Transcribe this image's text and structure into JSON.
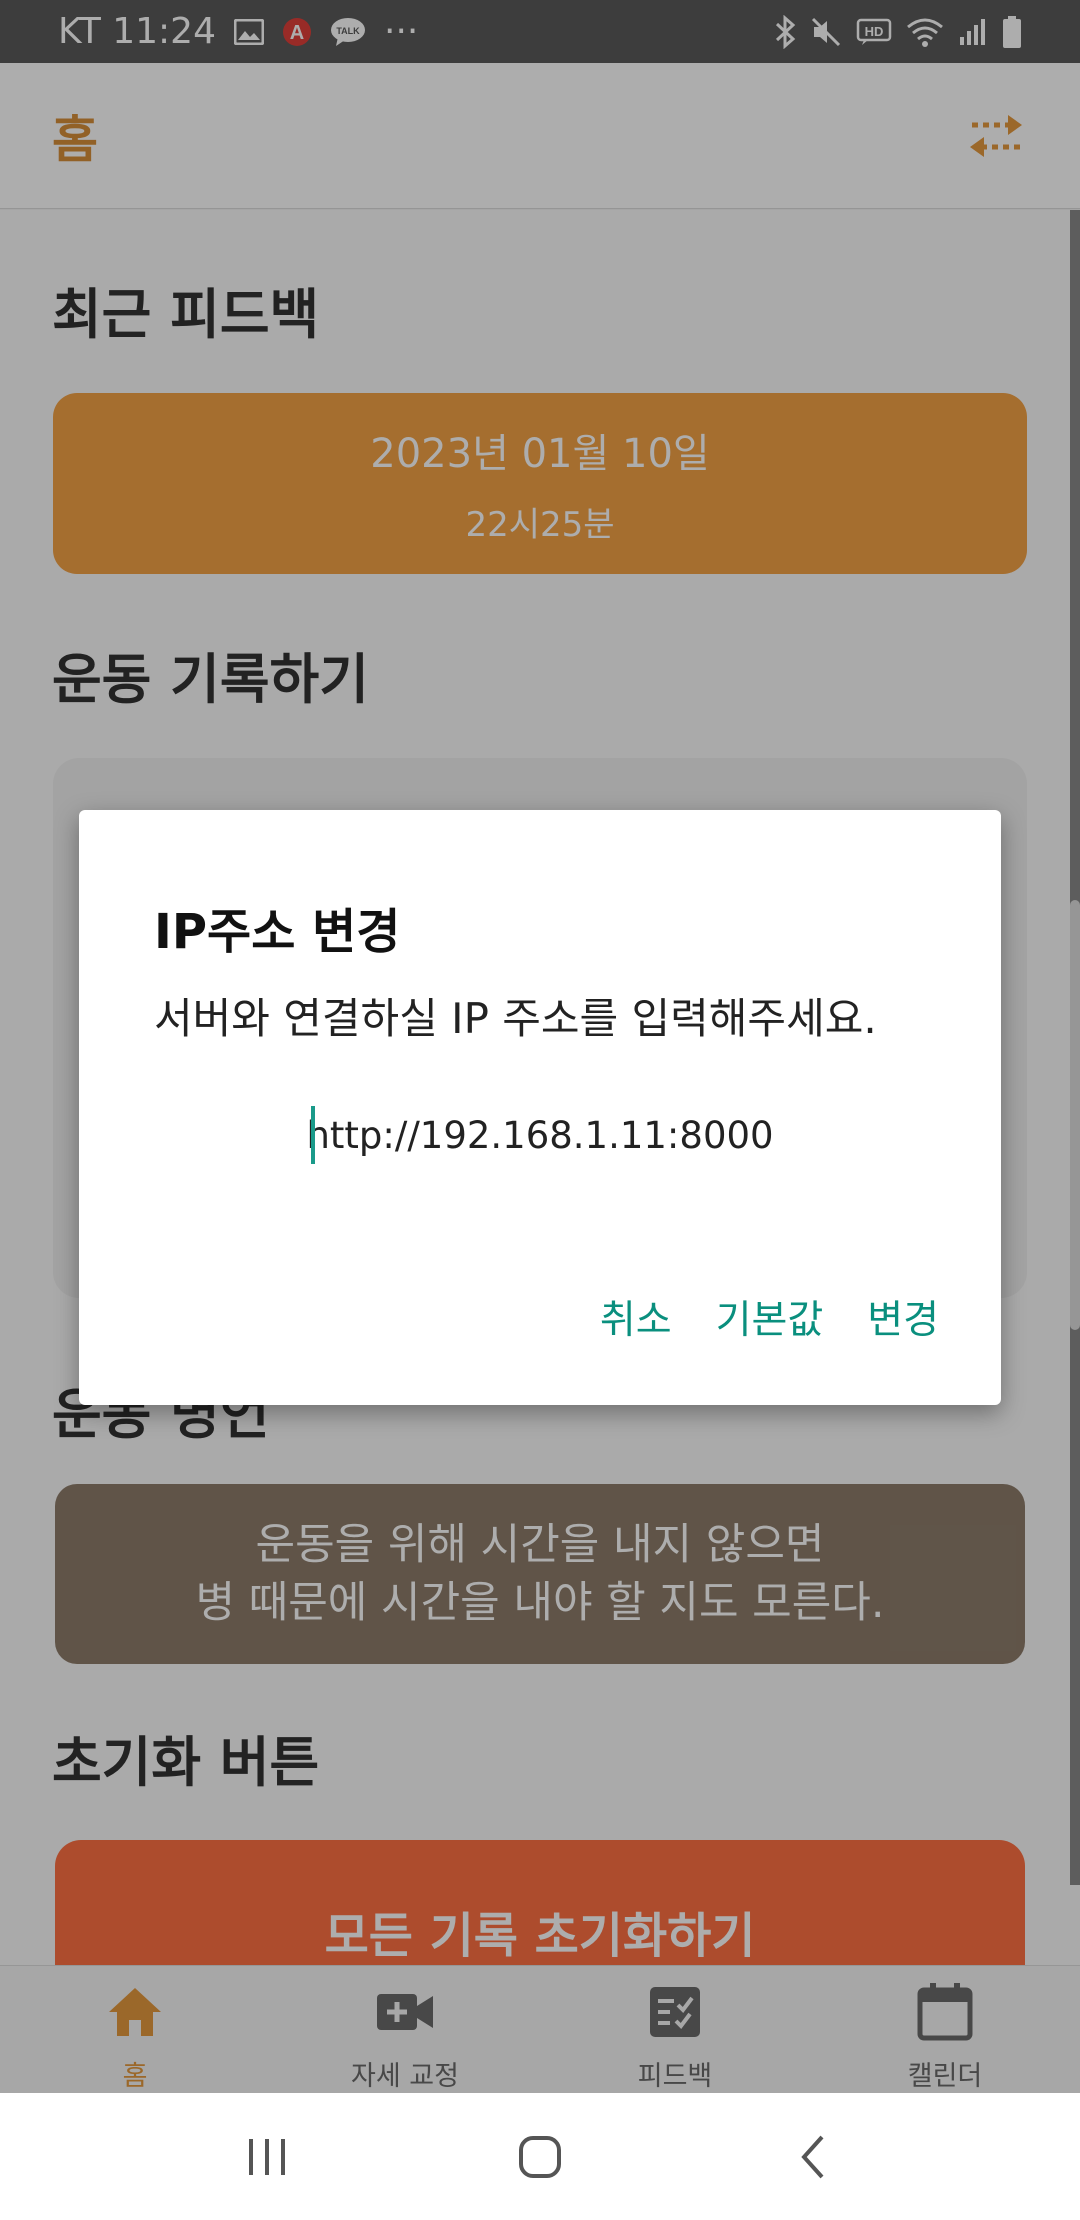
{
  "status_bar": {
    "carrier_time": "KT 11:24",
    "more": "···"
  },
  "app_bar": {
    "title": "홈"
  },
  "sections": {
    "recent_feedback_title": "최근 피드백",
    "record_title": "운동 기록하기",
    "quote_title": "운동 명언",
    "reset_title": "초기화 버튼"
  },
  "feedback_card": {
    "date": "2023년 01월 10일",
    "time": "22시25분"
  },
  "quote": {
    "line1": "운동을 위해 시간을 내지 않으면",
    "line2": "병 때문에 시간을 내야 할 지도 모른다."
  },
  "reset_button": {
    "label": "모든 기록 초기화하기"
  },
  "bottom_nav": {
    "items": [
      {
        "label": "홈",
        "icon": "home-icon",
        "active": true
      },
      {
        "label": "자세 교정",
        "icon": "video-add-icon",
        "active": false
      },
      {
        "label": "피드백",
        "icon": "checklist-icon",
        "active": false
      },
      {
        "label": "캘린더",
        "icon": "calendar-icon",
        "active": false
      }
    ]
  },
  "dialog": {
    "title": "IP주소 변경",
    "message": "서버와 연결하실 IP 주소를 입력해주세요.",
    "input_value": "http://192.168.1.11:8000",
    "buttons": {
      "cancel": "취소",
      "default": "기본값",
      "change": "변경"
    }
  },
  "colors": {
    "accent": "#e59a3e",
    "feedback_card": "#f3a246",
    "quote_card": "#8e7d6b",
    "reset_card": "#ff7143",
    "dialog_button": "#0a8f7e"
  }
}
